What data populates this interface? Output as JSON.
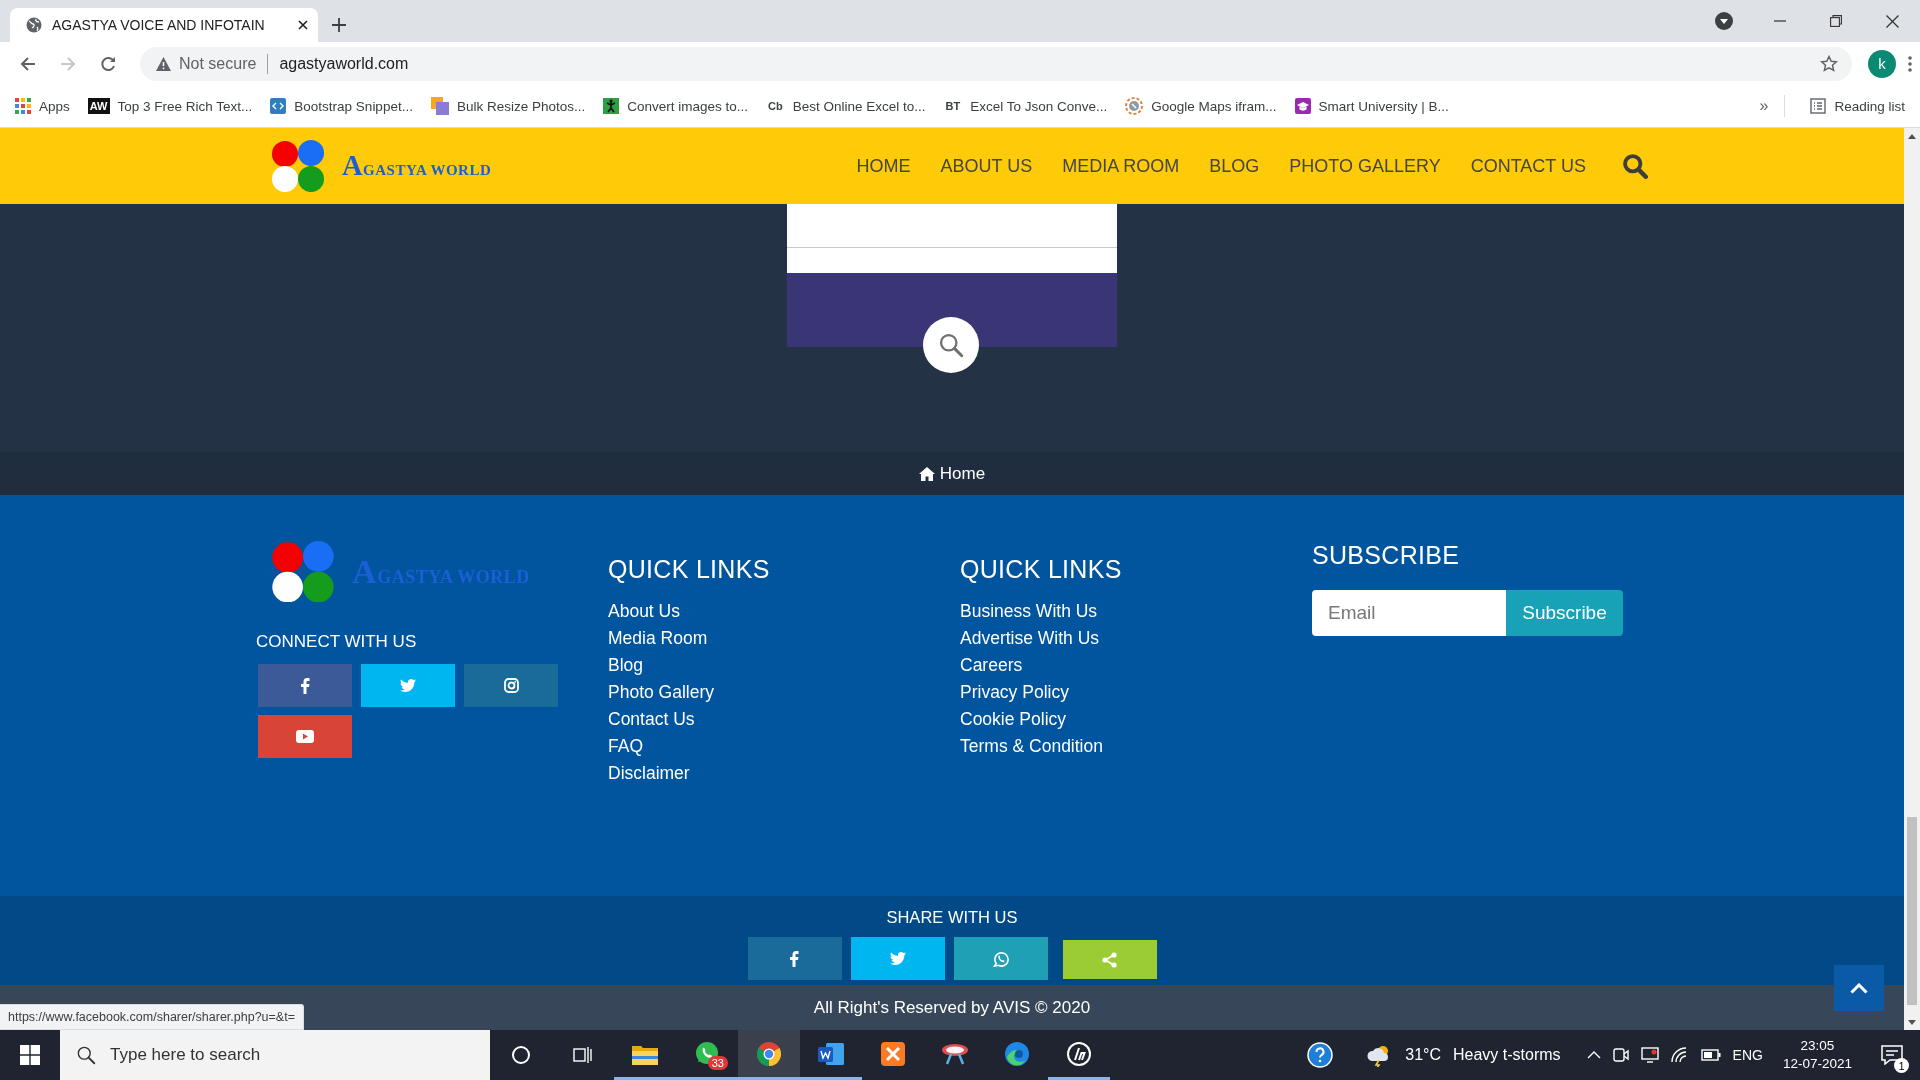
{
  "browser": {
    "tab_title": "AGASTYA VOICE AND INFOTAIN",
    "nav": {
      "back_enabled": true,
      "forward_enabled": false
    },
    "security_label": "Not secure",
    "url": "agastyaworld.com",
    "profile_initial": "k",
    "bookmarks": [
      {
        "label": "Apps",
        "kind": "grid"
      },
      {
        "label": "Top 3 Free Rich Text...",
        "kind": "badge",
        "icon_text": "AW"
      },
      {
        "label": "Bootstrap Snippet...",
        "kind": "code"
      },
      {
        "label": "Bulk Resize Photos...",
        "kind": "squares"
      },
      {
        "label": "Convert images to...",
        "kind": "figure"
      },
      {
        "label": "Best Online Excel to...",
        "kind": "lettered",
        "icon_text": "Cb"
      },
      {
        "label": "Excel To Json Conve...",
        "kind": "lettered",
        "icon_text": "BT"
      },
      {
        "label": "Google Maps ifram...",
        "kind": "compass"
      },
      {
        "label": "Smart University | B...",
        "kind": "cap"
      }
    ],
    "bookmarks_overflow": "»",
    "reading_list": "Reading list"
  },
  "site_header": {
    "logo_text": "AGASTYA WORLD",
    "nav": [
      "HOME",
      "ABOUT US",
      "MEDIA ROOM",
      "BLOG",
      "PHOTO GALLERY",
      "CONTACT US"
    ]
  },
  "breadcrumb": {
    "label": "Home"
  },
  "footer": {
    "logo_text": "AGASTYA WORLD",
    "connect_heading": "CONNECT WITH US",
    "social": [
      {
        "kind": "facebook",
        "color": "#3d5a98"
      },
      {
        "kind": "twitter",
        "color": "#00b6f1"
      },
      {
        "kind": "instagram",
        "color": "#1a6b9a"
      },
      {
        "kind": "youtube",
        "color": "#d84435"
      }
    ],
    "link_columns": [
      {
        "heading": "QUICK LINKS",
        "links": [
          "About Us",
          "Media Room",
          "Blog",
          "Photo Gallery",
          "Contact Us",
          "FAQ",
          "Disclaimer"
        ]
      },
      {
        "heading": "QUICK LINKS",
        "links": [
          "Business With Us",
          "Advertise With Us",
          "Careers",
          "Privacy Policy",
          "Cookie Policy",
          "Terms & Condition"
        ]
      }
    ],
    "subscribe": {
      "heading": "SUBSCRIBE",
      "placeholder": "Email",
      "button": "Subscribe"
    }
  },
  "share": {
    "heading": "SHARE WITH US",
    "buttons": [
      {
        "kind": "facebook",
        "color": "#1a6b9a"
      },
      {
        "kind": "twitter",
        "color": "#00b6f1"
      },
      {
        "kind": "whatsapp",
        "color": "#1fa0b4"
      },
      {
        "kind": "share",
        "color": "#9ccc34"
      }
    ]
  },
  "copyright": "All Right's Reserved by AVIS © 2020",
  "status_url": "https://www.facebook.com/sharer/sharer.php?u=&t=",
  "taskbar": {
    "search_placeholder": "Type here to search",
    "apps": [
      {
        "kind": "explorer",
        "running": true,
        "selected": false
      },
      {
        "kind": "whatsapp",
        "running": true,
        "selected": false,
        "badge": "33"
      },
      {
        "kind": "chrome",
        "running": true,
        "selected": true
      },
      {
        "kind": "word",
        "running": true,
        "selected": false
      },
      {
        "kind": "xampp",
        "running": false,
        "selected": false
      },
      {
        "kind": "snip",
        "running": false,
        "selected": false
      },
      {
        "kind": "edge",
        "running": false,
        "selected": false
      },
      {
        "kind": "hp",
        "running": true,
        "selected": false
      }
    ],
    "weather": {
      "temperature": "31°C",
      "condition": "Heavy t-storms"
    },
    "language": "ENG",
    "time": "23:05",
    "date": "12-07-2021",
    "notification_count": "1"
  }
}
